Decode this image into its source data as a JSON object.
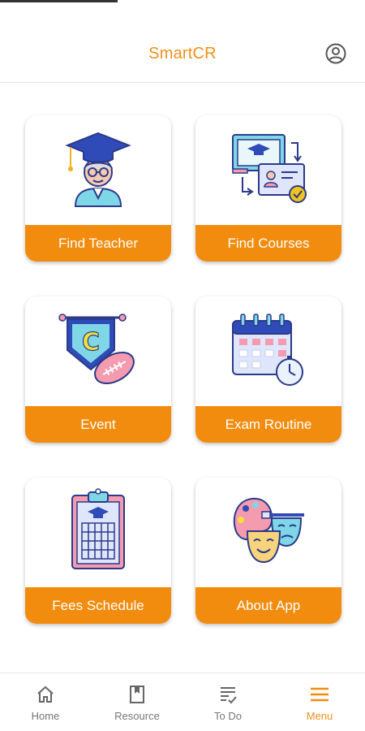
{
  "app": {
    "title": "SmartCR"
  },
  "colors": {
    "accent": "#f28c0f",
    "title": "#f0901b",
    "nav_inactive": "#777777"
  },
  "header": {
    "profile_icon": "account-circle-icon"
  },
  "menu_cards": [
    {
      "label": "Find Teacher",
      "icon": "teacher-graduate-icon"
    },
    {
      "label": "Find Courses",
      "icon": "course-board-icon"
    },
    {
      "label": "Event",
      "icon": "event-pennant-football-icon"
    },
    {
      "label": "Exam Routine",
      "icon": "calendar-clock-icon"
    },
    {
      "label": "Fees Schedule",
      "icon": "clipboard-grid-icon"
    },
    {
      "label": "About App",
      "icon": "palette-masks-icon"
    }
  ],
  "bottom_nav": [
    {
      "label": "Home",
      "icon": "home-icon",
      "active": false
    },
    {
      "label": "Resource",
      "icon": "bookmark-book-icon",
      "active": false
    },
    {
      "label": "To Do",
      "icon": "checklist-icon",
      "active": false
    },
    {
      "label": "Menu",
      "icon": "hamburger-menu-icon",
      "active": true
    }
  ]
}
